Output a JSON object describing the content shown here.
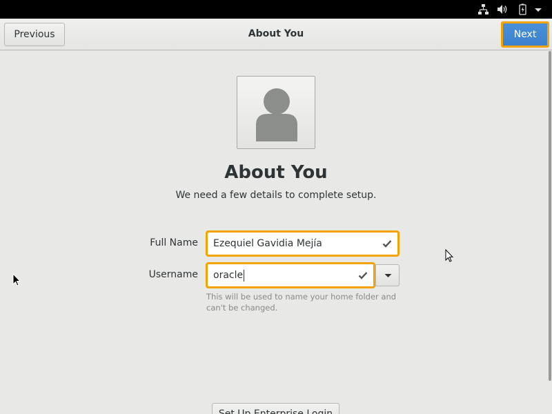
{
  "header": {
    "title": "About You",
    "previous_label": "Previous",
    "next_label": "Next"
  },
  "main": {
    "heading": "About You",
    "subtitle": "We need a few details to complete setup.",
    "full_name": {
      "label": "Full Name",
      "value": "Ezequiel Gavidia Mejía"
    },
    "username": {
      "label": "Username",
      "value": "oracle",
      "hint": "This will be used to name your home folder and can't be changed."
    },
    "enterprise_login_label": "Set Up Enterprise Login"
  },
  "icons": {
    "tray": [
      "network-icon",
      "volume-icon",
      "battery-icon",
      "system-menu-arrow-icon"
    ],
    "avatar": "user-avatar-icon",
    "entry_check": "checkmark-icon",
    "dropdown": "chevron-down-icon"
  },
  "colors": {
    "accent_blue": "#4a90d9",
    "focus_orange": "#f5a300",
    "background": "#e8e8e7"
  }
}
